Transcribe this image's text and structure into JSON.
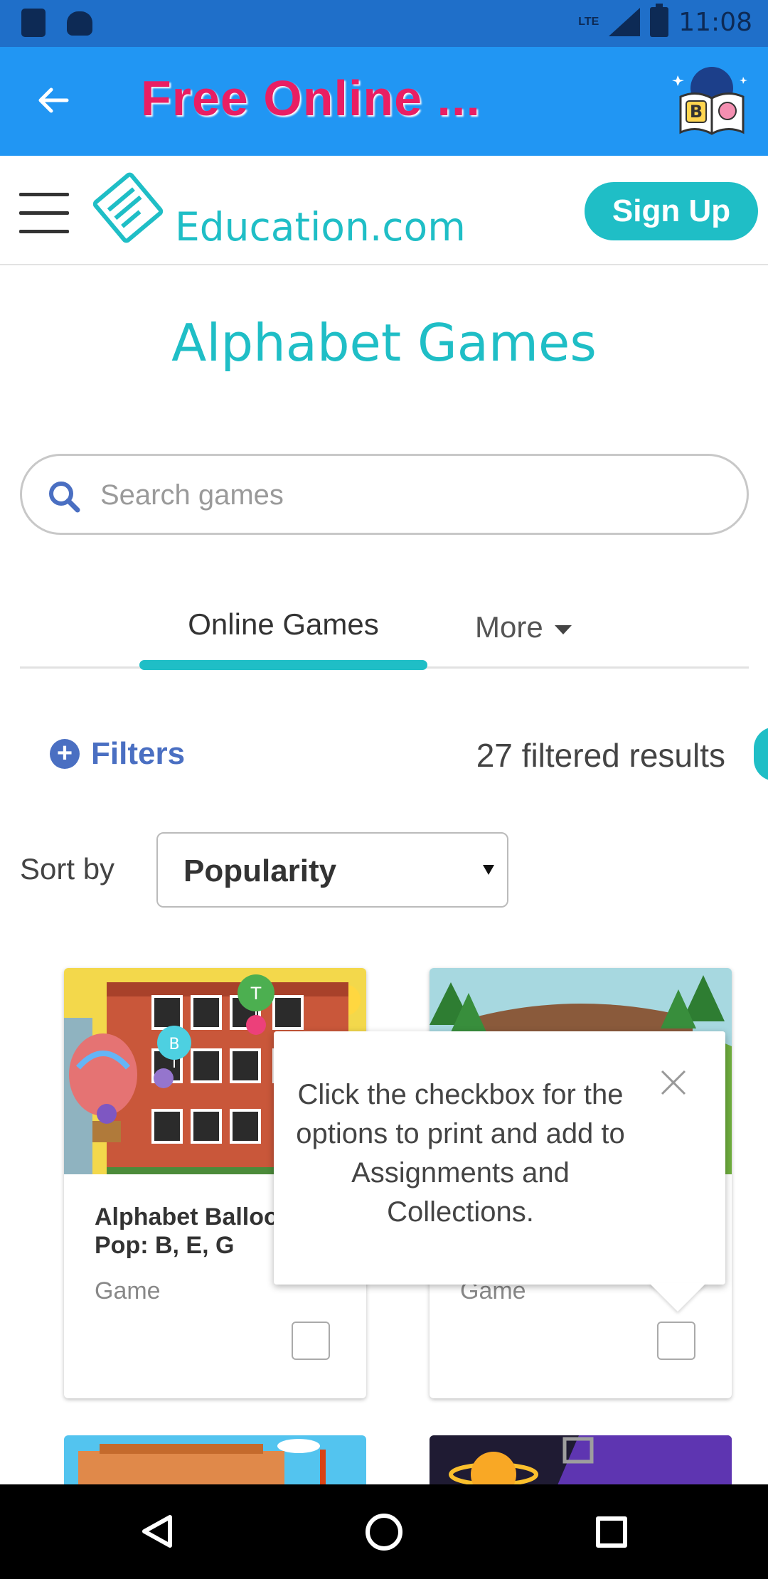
{
  "status_bar": {
    "network": "LTE",
    "time": "11:08"
  },
  "app_bar": {
    "title": "Free Online ...",
    "logo_letter": "B"
  },
  "site_header": {
    "brand": "Education.com",
    "signup_label": "Sign Up"
  },
  "page": {
    "title": "Alphabet Games"
  },
  "search": {
    "placeholder": "Search games",
    "value": ""
  },
  "tabs": {
    "active_label": "Online Games",
    "more_label": "More"
  },
  "filters": {
    "label": "Filters",
    "results_text": "27 filtered results"
  },
  "sort": {
    "label": "Sort by",
    "value": "Popularity"
  },
  "cards": [
    {
      "title": "Alphabet Balloo\nPop: B, E, G",
      "type": "Game",
      "balloon_letters": [
        "T",
        "B"
      ]
    },
    {
      "title": "",
      "type": "Game"
    }
  ],
  "tooltip": {
    "text": "Click the checkbox for the options to print and add to Assignments and Collections."
  },
  "colors": {
    "status_bar": "#1f6fc9",
    "app_bar": "#2196f3",
    "accent_teal": "#1fbec6",
    "title_pink": "#e91e63",
    "filters_blue": "#4a6fc2"
  },
  "icons": [
    "back-arrow-icon",
    "hamburger-icon",
    "education-logo-icon",
    "search-icon",
    "plus-circle-icon",
    "caret-down-icon",
    "close-icon",
    "nav-back-icon",
    "nav-home-icon",
    "nav-recent-icon"
  ]
}
